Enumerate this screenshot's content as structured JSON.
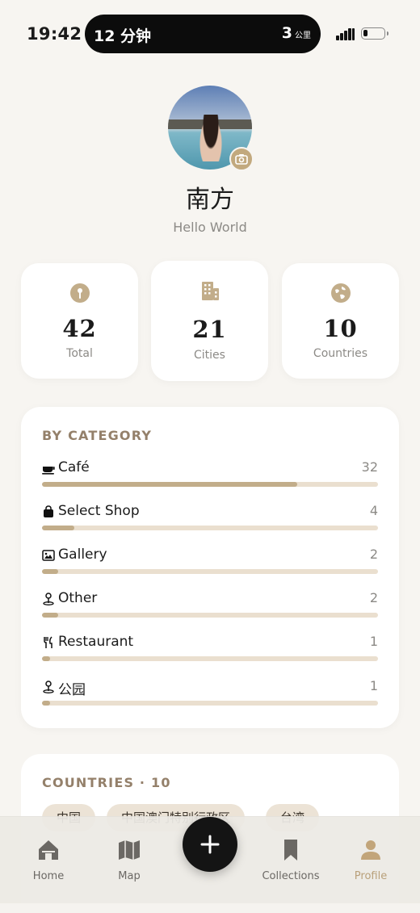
{
  "status_bar": {
    "time": "19:42",
    "island_left": "12 分钟",
    "island_right_value": "3",
    "island_right_unit": "公里"
  },
  "profile": {
    "name": "南方",
    "bio": "Hello World"
  },
  "stats": [
    {
      "icon": "pin-icon",
      "value": "42",
      "label": "Total"
    },
    {
      "icon": "building-icon",
      "value": "21",
      "label": "Cities"
    },
    {
      "icon": "globe-icon",
      "value": "10",
      "label": "Countries"
    }
  ],
  "categories": {
    "title": "BY CATEGORY",
    "items": [
      {
        "icon": "coffee-icon",
        "label": "Café",
        "count": "32",
        "fraction": 0.76
      },
      {
        "icon": "shopping-bag-icon",
        "label": "Select Shop",
        "count": "4",
        "fraction": 0.095
      },
      {
        "icon": "gallery-icon",
        "label": "Gallery",
        "count": "2",
        "fraction": 0.048
      },
      {
        "icon": "map-pin-icon",
        "label": "Other",
        "count": "2",
        "fraction": 0.048
      },
      {
        "icon": "fork-knife-icon",
        "label": "Restaurant",
        "count": "1",
        "fraction": 0.024
      },
      {
        "icon": "map-pin-icon",
        "label": "公园",
        "count": "1",
        "fraction": 0.024
      }
    ]
  },
  "countries": {
    "title": "COUNTRIES · 10",
    "chips": [
      "中国",
      "中国澳门特别行政区",
      "台湾"
    ]
  },
  "tab_bar": {
    "tabs": [
      {
        "icon": "home-icon",
        "label": "Home"
      },
      {
        "icon": "map-icon",
        "label": "Map"
      },
      {
        "icon": "bookmark-icon",
        "label": "Collections"
      },
      {
        "icon": "profile-icon",
        "label": "Profile"
      }
    ],
    "active": "Profile"
  },
  "colors": {
    "accent": "#c2ad8a",
    "track": "#eadfcf",
    "section_title": "#94806a",
    "background": "#f7f5f1"
  }
}
